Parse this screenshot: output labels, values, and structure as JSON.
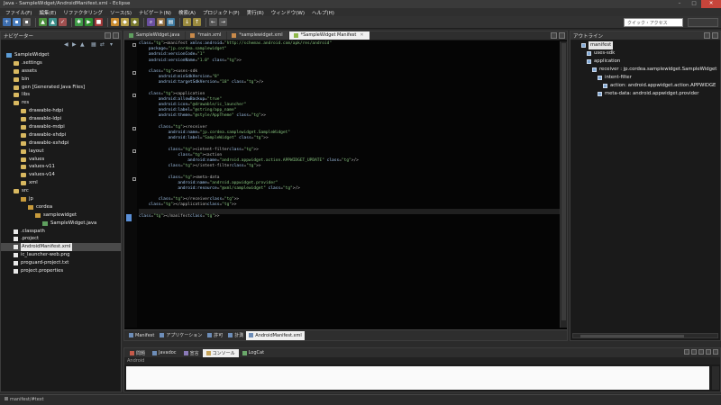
{
  "window": {
    "title": "Java - SampleWidget/AndroidManifest.xml - Eclipse"
  },
  "menu": [
    "ファイル(F)",
    "編集(E)",
    "リファクタリング",
    "ソース(S)",
    "ナビゲート(N)",
    "検索(A)",
    "プロジェクト(P)",
    "実行(R)",
    "ウィンドウ(W)",
    "ヘルプ(H)"
  ],
  "toolbar": {
    "quick_access_placeholder": "クイック・アクセス"
  },
  "navigator": {
    "title": "ナビゲーター",
    "items": [
      {
        "label": "SampleWidget",
        "level": 0,
        "kind": "proj"
      },
      {
        "label": ".settings",
        "level": 1,
        "kind": "fold"
      },
      {
        "label": "assets",
        "level": 1,
        "kind": "fold"
      },
      {
        "label": "bin",
        "level": 1,
        "kind": "fold"
      },
      {
        "label": "gen [Generated Java Files]",
        "level": 1,
        "kind": "fold"
      },
      {
        "label": "libs",
        "level": 1,
        "kind": "fold"
      },
      {
        "label": "res",
        "level": 1,
        "kind": "fold"
      },
      {
        "label": "drawable-hdpi",
        "level": 2,
        "kind": "fold"
      },
      {
        "label": "drawable-ldpi",
        "level": 2,
        "kind": "fold"
      },
      {
        "label": "drawable-mdpi",
        "level": 2,
        "kind": "fold"
      },
      {
        "label": "drawable-xhdpi",
        "level": 2,
        "kind": "fold"
      },
      {
        "label": "drawable-xxhdpi",
        "level": 2,
        "kind": "fold"
      },
      {
        "label": "layout",
        "level": 2,
        "kind": "fold"
      },
      {
        "label": "values",
        "level": 2,
        "kind": "fold"
      },
      {
        "label": "values-v11",
        "level": 2,
        "kind": "fold"
      },
      {
        "label": "values-v14",
        "level": 2,
        "kind": "fold"
      },
      {
        "label": "xml",
        "level": 2,
        "kind": "fold"
      },
      {
        "label": "src",
        "level": 1,
        "kind": "fold"
      },
      {
        "label": "jp",
        "level": 2,
        "kind": "pkg"
      },
      {
        "label": "cordea",
        "level": 3,
        "kind": "pkg"
      },
      {
        "label": "samplewidget",
        "level": 4,
        "kind": "pkg"
      },
      {
        "label": "SampleWidget.java",
        "level": 5,
        "kind": "java"
      },
      {
        "label": ".classpath",
        "level": 1,
        "kind": "file"
      },
      {
        "label": ".project",
        "level": 1,
        "kind": "file"
      },
      {
        "label": "AndroidManifest.xml",
        "level": 1,
        "kind": "file",
        "selected": true
      },
      {
        "label": "ic_launcher-web.png",
        "level": 1,
        "kind": "file"
      },
      {
        "label": "proguard-project.txt",
        "level": 1,
        "kind": "file"
      },
      {
        "label": "project.properties",
        "level": 1,
        "kind": "file"
      }
    ]
  },
  "editor": {
    "tabs": [
      {
        "label": "SampleWidget.java",
        "active": false
      },
      {
        "label": "*main.xml",
        "active": false
      },
      {
        "label": "*samplewidget.xml",
        "active": false
      },
      {
        "label": "*SampleWidget Manifest",
        "active": true
      }
    ],
    "lines": [
      "<manifest xmlns:android=\"http://schemas.android.com/apk/res/android\"",
      "    package=\"jp.cordea.samplewidget\"",
      "    android:versionCode=\"1\"",
      "    android:versionName=\"1.0\" >",
      "",
      "    <uses-sdk",
      "        android:minSdkVersion=\"8\"",
      "        android:targetSdkVersion=\"18\" />",
      "",
      "    <application",
      "        android:allowBackup=\"true\"",
      "        android:icon=\"@drawable/ic_launcher\"",
      "        android:label=\"@string/app_name\"",
      "        android:theme=\"@style/AppTheme\" >",
      "",
      "        <receiver",
      "            android:name=\"jp.cordea.samplewidget.SampleWidget\"",
      "            android:label=\"SampleWidget\" >",
      "",
      "            <intent-filter>",
      "                <action",
      "                    android:name=\"android.appwidget.action.APPWIDGET_UPDATE\" />",
      "            </intent-filter>",
      "",
      "            <meta-data",
      "                android:name=\"android.appwidget.provider\"",
      "                android:resource=\"@xml/samplewidget\" />",
      "",
      "        </receiver>",
      "    </application>",
      "",
      "</manifest>"
    ],
    "current_line": 30,
    "bottom_tabs": [
      {
        "label": "Manifest",
        "active": false
      },
      {
        "label": "アプリケーション",
        "active": false
      },
      {
        "label": "許可",
        "active": false
      },
      {
        "label": "計測",
        "active": false
      },
      {
        "label": "AndroidManifest.xml",
        "active": true
      }
    ]
  },
  "outline": {
    "title": "アウトライン",
    "items": [
      {
        "label": "manifest",
        "level": 0,
        "selected": true
      },
      {
        "label": "uses-sdk",
        "level": 1
      },
      {
        "label": "application",
        "level": 1
      },
      {
        "label": "receiver : jp.cordea.samplewidget.SampleWidget",
        "level": 2
      },
      {
        "label": "intent-filter",
        "level": 3
      },
      {
        "label": "action: android.appwidget.action.APPWIDGE",
        "level": 4
      },
      {
        "label": "meta-data: android.appwidget.provider",
        "level": 3
      }
    ]
  },
  "console": {
    "tabs": [
      {
        "label": "問題",
        "active": false
      },
      {
        "label": "Javadoc",
        "active": false
      },
      {
        "label": "宣言",
        "active": false
      },
      {
        "label": "コンソール",
        "active": true
      },
      {
        "label": "LogCat",
        "active": false
      }
    ],
    "label": "Android"
  },
  "status": {
    "text": "manifest/#text"
  }
}
